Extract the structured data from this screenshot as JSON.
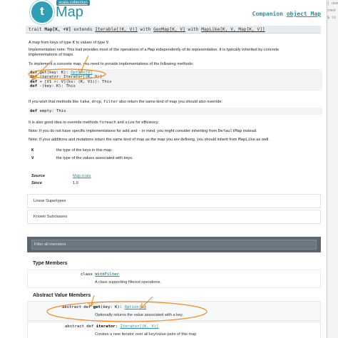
{
  "header": {
    "package_label": "scala.collection",
    "logo_letter": "t",
    "title": "Map",
    "companion_prefix": "Companion",
    "companion_link": "object Map"
  },
  "signature": {
    "trait_kw": "trait",
    "name": "Map[K, +V]",
    "extends_kw": "extends",
    "t1": "Iterable[(K, V)]",
    "with1": "with",
    "t2": "GenMap[K, V]",
    "with2": "with",
    "t3": "MapLike[K, V, Map[K, V]]"
  },
  "doc": {
    "intro_1": "A map from keys of type",
    "intro_k": "K",
    "intro_2": "to values of type",
    "intro_v": "V",
    "impl_note_1": "Implementation note: This trait provides most of the operations of a",
    "impl_note_map": "Map",
    "impl_note_2": "independently of its representation. It is typically inherited by concrete",
    "impl_note_3": "implementations of maps.",
    "to_implement": "To implement a concrete map, you need to provide implementations of the following methods:",
    "code1": [
      {
        "kw": "def",
        "rest": " get(key: K): ",
        "link": "Option[V]"
      },
      {
        "kw": "def",
        "rest": " iterator: Iterator[(K, V)]",
        "link": ""
      },
      {
        "kw": "def",
        "rest": " + [V1 >: V](kv: (K, V1)): This",
        "link": ""
      },
      {
        "kw": "def",
        "rest": " -(key: K): This",
        "link": ""
      }
    ],
    "empty_1": "If you wish that methods like",
    "empty_take": "take",
    "empty_drop": "drop",
    "empty_filter": "filter",
    "empty_2": "also return the same kind of map you should also override:",
    "code2_kw": "def",
    "code2_rest": " empty: This",
    "foreach_1": "It is also good idea to override methods",
    "foreach_m": "foreach",
    "foreach_and": "and",
    "foreach_size": "size",
    "foreach_2": "for efficiency.",
    "note1_1": "Note: If you do not have specific implementations for",
    "note1_add": "add",
    "note1_and": "and",
    "note1_minus": "-",
    "note1_2": "in mind, you might consider inheriting from",
    "note1_dm": "DefaultMap",
    "note1_3": "instead.",
    "note2_1": "Note: If your additions and mutations return the same kind of map as the map you are defining, you should inherit from",
    "note2_ml": "MapLike",
    "note2_2": "as well."
  },
  "type_params": [
    {
      "name": "K",
      "desc": "the type of the keys in this map."
    },
    {
      "name": "V",
      "desc": "the type of the values associated with keys."
    }
  ],
  "meta": {
    "source_label": "Source",
    "source_value": "Map.scala",
    "since_label": "Since",
    "since_value": "1.0"
  },
  "panels": {
    "linear_supertypes": "Linear Supertypes",
    "known_subclasses": "Known Subclasses"
  },
  "filter": {
    "placeholder": "Filter all members"
  },
  "type_members": {
    "heading": "Type Members",
    "kw": "class",
    "name": "WithFilter",
    "desc": "A class supporting filtered operations."
  },
  "abstract_members": {
    "heading": "Abstract Value Members",
    "items": [
      {
        "mods": "abstract def",
        "name": "get",
        "params": "(key: K):",
        "ret": "Option[V]",
        "desc": "Optionally returns the value associated with a key."
      },
      {
        "mods": "abstract def",
        "name": "iterator",
        "params": ":",
        "ret": "Iterator[(K, V)]",
        "desc": "Creates a new iterator over all key/value pairs of this map"
      }
    ]
  },
  "right_strip": [
    "| use",
    "root",
    "$ ls",
    "",
    "",
    "",
    "",
    "",
    "",
    "",
    "",
    "",
    "",
    "",
    "",
    "",
    "",
    "",
    "",
    "",
    "",
    "",
    "",
    "",
    "",
    "",
    "",
    "",
    "",
    "",
    "",
    "",
    "",
    "",
    "",
    "",
    "",
    "",
    "",
    "",
    "",
    "",
    "",
    "",
    "",
    "",
    ""
  ],
  "colors": {
    "accent": "#2a8fa6",
    "annotation": "#f08a1c",
    "filter_bar": "#5a6770"
  }
}
